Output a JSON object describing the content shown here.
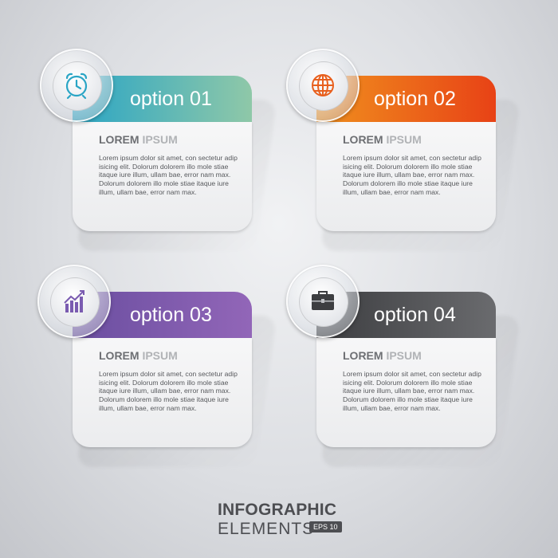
{
  "cards": [
    {
      "title": "option 01",
      "heading_bold": "LOREM",
      "heading_light": "IPSUM",
      "text": "Lorem ipsum dolor sit amet, con sectetur adip isicing elit. Dolorum dolorem illo mole stiae itaque iure illum, ullam bae, error nam max. Dolorum dolorem illo mole stiae itaque iure illum, ullam bae, error nam max.",
      "icon": "alarm-clock-icon",
      "color_from": "#2aa5c5",
      "color_to": "#8fc8a8"
    },
    {
      "title": "option 02",
      "heading_bold": "LOREM",
      "heading_light": "IPSUM",
      "text": "Lorem ipsum dolor sit amet, con sectetur adip isicing elit. Dolorum dolorem illo mole stiae itaque iure illum, ullam bae, error nam max. Dolorum dolorem illo mole stiae itaque iure illum, ullam bae, error nam max.",
      "icon": "globe-icon",
      "color_from": "#f0901e",
      "color_to": "#e84216"
    },
    {
      "title": "option 03",
      "heading_bold": "LOREM",
      "heading_light": "IPSUM",
      "text": "Lorem ipsum dolor sit amet, con sectetur adip isicing elit. Dolorum dolorem illo mole stiae itaque iure illum, ullam bae, error nam max. Dolorum dolorem illo mole stiae itaque iure illum, ullam bae, error nam max.",
      "icon": "bar-chart-icon",
      "color_from": "#6a4ea0",
      "color_to": "#9266b8"
    },
    {
      "title": "option 04",
      "heading_bold": "LOREM",
      "heading_light": "IPSUM",
      "text": "Lorem ipsum dolor sit amet, con sectetur adip isicing elit. Dolorum dolorem illo mole stiae itaque iure illum, ullam bae, error nam max. Dolorum dolorem illo mole stiae itaque iure illum, ullam bae, error nam max.",
      "icon": "briefcase-icon",
      "color_from": "#3c3d40",
      "color_to": "#6a6b6e"
    }
  ],
  "footer": {
    "title": "INFOGRAPHIC",
    "subtitle": "ELEMENTS",
    "badge": "EPS 10"
  }
}
